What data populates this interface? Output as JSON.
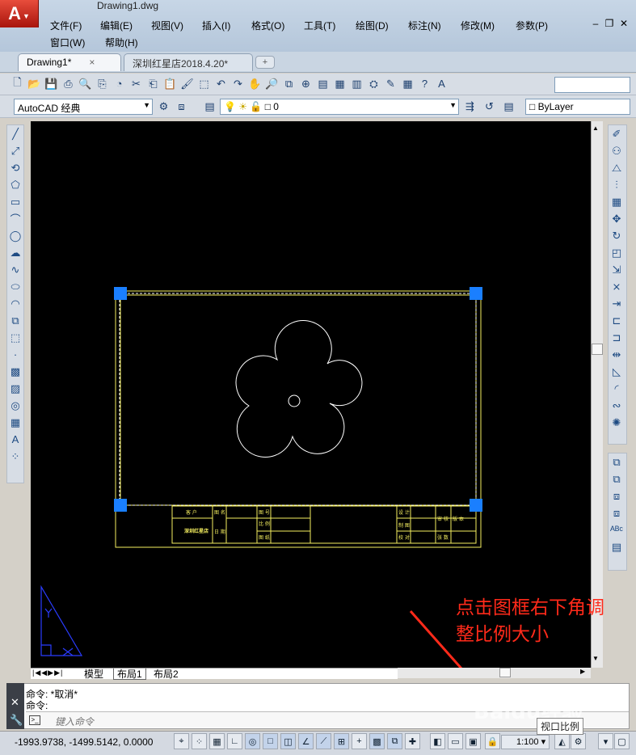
{
  "window": {
    "title": "Drawing1.dwg"
  },
  "menu": {
    "row1": [
      "文件(F)",
      "编辑(E)",
      "视图(V)",
      "插入(I)",
      "格式(O)",
      "工具(T)",
      "绘图(D)",
      "标注(N)",
      "修改(M)",
      "参数(P)"
    ],
    "row2": [
      "窗口(W)",
      "帮助(H)"
    ]
  },
  "tabs": [
    {
      "label": "Drawing1*",
      "close": "×"
    },
    {
      "label": "深圳红星店2018.4.20*"
    }
  ],
  "toolbar": {
    "workspace": "AutoCAD 经典",
    "layer": "0",
    "linetype": "ByLayer"
  },
  "title_block": {
    "r1": [
      "客 户",
      "图 名",
      "图 号",
      "设 计",
      "审 核"
    ],
    "r2": [
      "深圳红星店",
      "日 期",
      "比 例",
      "制 图",
      "版 本"
    ],
    "r3": [
      "图 纸",
      "校 对",
      "张 数"
    ]
  },
  "layout_tabs": [
    "模型",
    "布局1",
    "布局2"
  ],
  "command": {
    "line1": "命令: *取消*",
    "line2": "命令:",
    "placeholder": "键入命令"
  },
  "status": {
    "coords": "-1993.9738, -1499.5142, 0.0000",
    "scale": "1:100"
  },
  "annotation": {
    "line1": "点击图框右下角调",
    "line2": "整比例大小"
  },
  "tooltip": "视口比例",
  "watermark": "Baidu经验",
  "colors": {
    "accent": "#ff2a1a",
    "grip": "#1a7fff",
    "title_block_line": "#f6f060",
    "ucs": "#2a3cff"
  }
}
